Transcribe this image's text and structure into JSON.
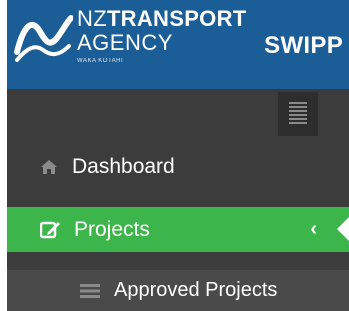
{
  "header": {
    "org_line1_prefix": "NZ",
    "org_line1_main": "TRANSPORT",
    "org_line2": "AGENCY",
    "org_line3": "WAKA KOTAHI",
    "app_title": "SWIPP"
  },
  "sidebar": {
    "items": [
      {
        "label": "Dashboard",
        "icon": "home-icon"
      },
      {
        "label": "Projects",
        "icon": "edit-icon",
        "active": true
      },
      {
        "label": "Approved Projects",
        "icon": "list-icon"
      }
    ],
    "chevron": "‹"
  },
  "colors": {
    "header_bg": "#1b5d97",
    "sidebar_bg": "#3c3c3c",
    "active_bg": "#3cb54a",
    "submenu_bg": "#4a4a4a"
  }
}
